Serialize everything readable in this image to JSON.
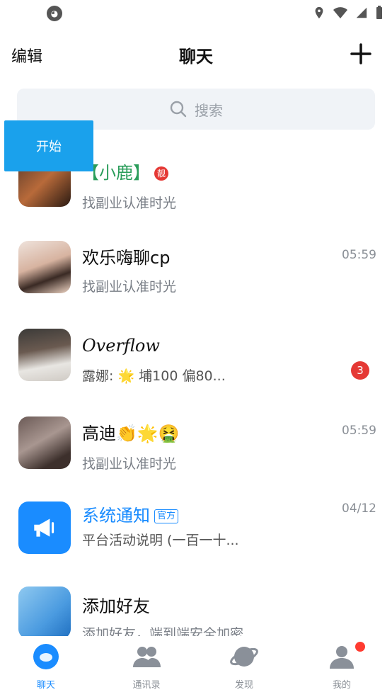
{
  "status_bar": {
    "app_icon": "cat-icon",
    "icons": [
      "location-icon",
      "wifi-icon",
      "signal-icon",
      "battery-icon"
    ]
  },
  "header": {
    "edit_label": "编辑",
    "title": "聊天",
    "plus_icon": "plus-icon"
  },
  "search": {
    "placeholder": "搜索"
  },
  "overlay_button": {
    "label": "开始"
  },
  "conversations": [
    {
      "name": "【小鹿】",
      "preview": "找副业认准时光",
      "time": "",
      "badge": "",
      "tag": "靓"
    },
    {
      "name": "欢乐嗨聊cp",
      "preview": "找副业认准时光",
      "time": "05:59",
      "badge": "",
      "tag": ""
    },
    {
      "name": "Overflow",
      "preview": "露娜: 🌟 埔100 偏80...",
      "time": "",
      "badge": "3",
      "tag": ""
    },
    {
      "name": "高迪👏🌟🤮",
      "preview": "找副业认准时光",
      "time": "05:59",
      "badge": "",
      "tag": ""
    },
    {
      "name": "系统通知",
      "preview": "平台活动说明 (一百一十...",
      "time": "04/12",
      "badge": "",
      "tag": "官方"
    },
    {
      "name": "添加好友",
      "preview": "添加好友，端到端安全加密",
      "time": "",
      "badge": "",
      "tag": ""
    }
  ],
  "tabs": [
    {
      "label": "聊天",
      "icon": "chat-bubble-icon",
      "active": true
    },
    {
      "label": "通讯录",
      "icon": "contacts-icon",
      "active": false
    },
    {
      "label": "发现",
      "icon": "planet-icon",
      "active": false
    },
    {
      "label": "我的",
      "icon": "profile-icon",
      "active": false
    }
  ],
  "colors": {
    "accent": "#1a8cff",
    "overlay": "#1aa1ec",
    "badge": "#e53935"
  }
}
